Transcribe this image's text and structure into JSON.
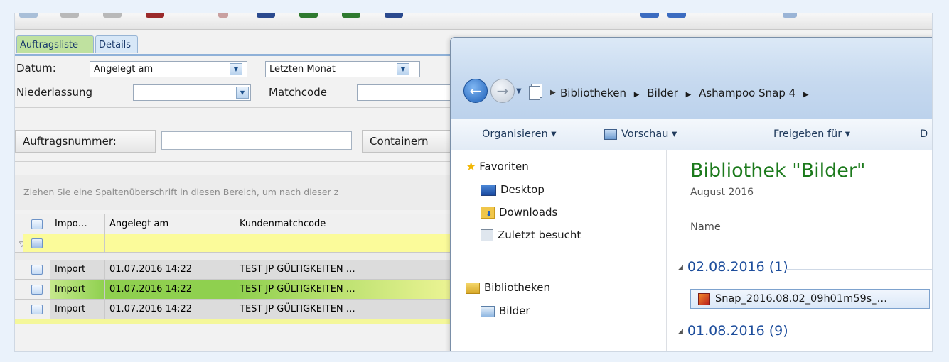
{
  "app": {
    "tabs": [
      {
        "label": "Auftragsliste"
      },
      {
        "label": "Details"
      }
    ],
    "filters": {
      "datum_label": "Datum:",
      "datum_value": "Angelegt am",
      "period_value": "Letzten Monat",
      "niederlassung_label": "Niederlassung",
      "niederlassung_value": "",
      "matchcode_label": "Matchcode",
      "auftragsnummer_label": "Auftragsnummer:",
      "container_button": "Containern"
    },
    "group_hint": "Ziehen Sie eine Spaltenüberschrift in diesen Bereich, um nach dieser z",
    "grid": {
      "columns": [
        "Impo…",
        "Angelegt am",
        "Kundenmatchcode"
      ],
      "rows": [
        {
          "type": "Import",
          "created": "01.07.2016  14:22",
          "customer": "TEST JP GÜLTIGKEITEN …"
        },
        {
          "type": "Import",
          "created": "01.07.2016  14:22",
          "customer": "TEST JP GÜLTIGKEITEN …"
        },
        {
          "type": "Import",
          "created": "01.07.2016  14:22",
          "customer": "TEST JP GÜLTIGKEITEN …"
        }
      ]
    }
  },
  "explorer": {
    "breadcrumb": [
      "Bibliotheken",
      "Bilder",
      "Ashampoo Snap 4"
    ],
    "commands": {
      "organize": "Organisieren ▾",
      "preview": "Vorschau ▾",
      "share": "Freigeben für ▾",
      "more": "D"
    },
    "nav": {
      "favorites": "Favoriten",
      "desktop": "Desktop",
      "downloads": "Downloads",
      "recent": "Zuletzt besucht",
      "libraries": "Bibliotheken",
      "pictures": "Bilder"
    },
    "library_title": "Bibliothek \"Bilder\"",
    "library_subtitle": "August 2016",
    "column_name": "Name",
    "groups": [
      {
        "label": "02.08.2016 (1)"
      },
      {
        "label": "01.08.2016 (9)"
      }
    ],
    "file_name": "Snap_2016.08.02_09h01m59s_…"
  },
  "colors": {
    "tab_active": "#bfe19f",
    "filter_row": "#fbfb9a",
    "selected_row": "#8fd04f",
    "library_title": "#1c7a1c",
    "group_label": "#1e4e9c"
  }
}
